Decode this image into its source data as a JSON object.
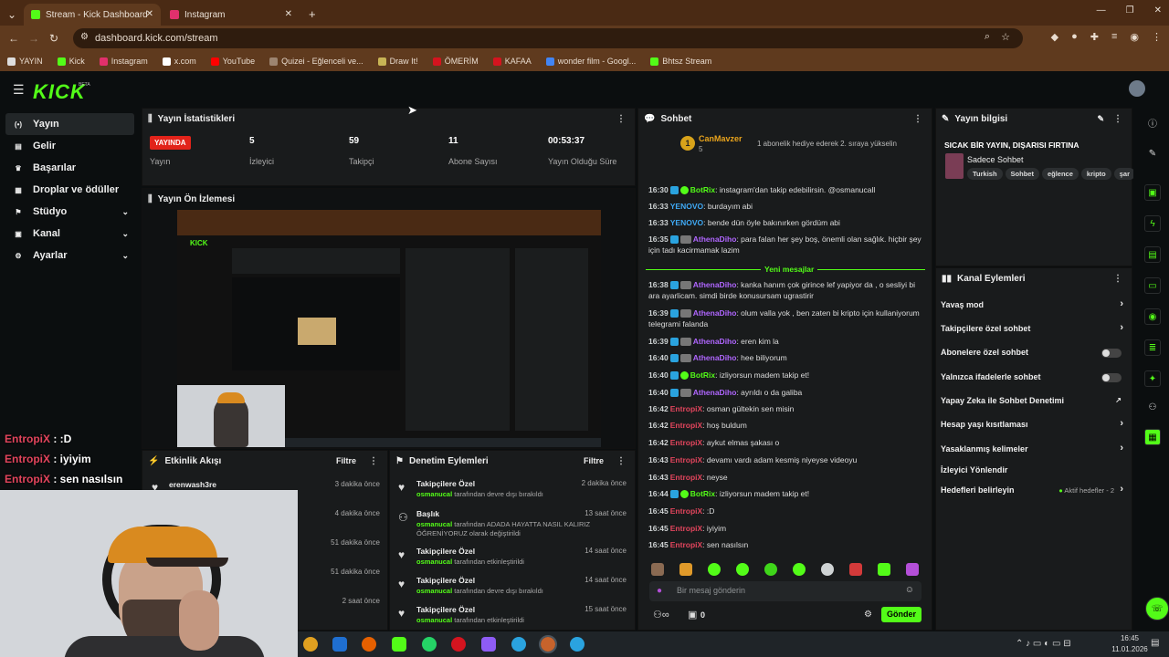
{
  "browser": {
    "tabs": [
      {
        "title": "Stream - Kick Dashboard",
        "active": true
      },
      {
        "title": "Instagram",
        "active": false
      }
    ],
    "url": "dashboard.kick.com/stream",
    "bookmarks": [
      "YAYIN",
      "Kick",
      "Instagram",
      "x.com",
      "YouTube",
      "Quizei - Eğlenceli ve...",
      "Draw It!",
      "ÖMERİM",
      "KAFAA",
      "wonder film - Googl...",
      "Bhtsz Stream"
    ]
  },
  "kick": {
    "logo": "KICK",
    "beta": "BETA",
    "sidebar": [
      {
        "label": "Yayın",
        "icon": "broadcast-icon",
        "active": true
      },
      {
        "label": "Gelir",
        "icon": "revenue-icon"
      },
      {
        "label": "Başarılar",
        "icon": "trophy-icon"
      },
      {
        "label": "Droplar ve ödüller",
        "icon": "gift-icon"
      },
      {
        "label": "Stüdyo",
        "icon": "studio-icon",
        "chevron": true
      },
      {
        "label": "Kanal",
        "icon": "channel-icon",
        "chevron": true
      },
      {
        "label": "Ayarlar",
        "icon": "gear-icon",
        "chevron": true
      }
    ],
    "stats": {
      "title": "Yayın İstatistikleri",
      "live_badge": "YAYINDA",
      "live_label": "Yayın",
      "viewers": "5",
      "viewers_label": "İzleyici",
      "followers": "59",
      "followers_label": "Takipçi",
      "subs": "11",
      "subs_label": "Abone Sayısı",
      "uptime": "00:53:37",
      "uptime_label": "Yayın Olduğu Süre"
    },
    "preview_title": "Yayın Ön İzlemesi",
    "overlay_chat": [
      {
        "user": "EntropiX",
        "msg": " : :D"
      },
      {
        "user": "EntropiX",
        "msg": " : iyiyim"
      },
      {
        "user": "EntropiX",
        "msg": " : sen nasılsın"
      }
    ],
    "activity": {
      "title": "Etkinlik Akışı",
      "filter": "Filtre",
      "items": [
        {
          "user": "erenwash3re",
          "time": "3 dakika önce"
        },
        {
          "user": "",
          "time": "4 dakika önce"
        },
        {
          "user": "",
          "time": "51 dakika önce"
        },
        {
          "user": "",
          "time": "51 dakika önce"
        },
        {
          "user": "",
          "time": "2 saat önce"
        }
      ]
    },
    "moderation": {
      "title": "Denetim Eylemleri",
      "filter": "Filtre",
      "items": [
        {
          "title": "Takipçilere Özel",
          "user": "osmanucal",
          "desc": " tarafından devre dışı bırakıldı",
          "time": "2 dakika önce"
        },
        {
          "title": "Başlık",
          "user": "osmanucal",
          "desc": " tarafından ADADA HAYATTA NASIL KALIRIZ ÖĞRENİYORUZ olarak değiştirildi",
          "time": "13 saat önce"
        },
        {
          "title": "Takipçilere Özel",
          "user": "osmanucal",
          "desc": " tarafından etkinleştirildi",
          "time": "14 saat önce"
        },
        {
          "title": "Takipçilere Özel",
          "user": "osmanucal",
          "desc": " tarafından devre dışı bırakıldı",
          "time": "14 saat önce"
        },
        {
          "title": "Takipçilere Özel",
          "user": "osmanucal",
          "desc": " tarafından etkinleştirildi",
          "time": "15 saat önce"
        }
      ]
    },
    "chat": {
      "title": "Sohbet",
      "pinned_user": "CanMavzer",
      "pinned_count": "5",
      "pinned_msg": "1 abonelik hediye ederek 2. sıraya yükselin",
      "new_messages": "Yeni mesajlar",
      "messages": [
        {
          "time": "16:30",
          "user": "BotRix",
          "color": "#53fc18",
          "text": ": instagram'dan takip edebilirsin. @osmanucall"
        },
        {
          "time": "16:33",
          "user": "YENOVO",
          "color": "#3fa9f5",
          "text": ": burdayım abi"
        },
        {
          "time": "16:33",
          "user": "YENOVO",
          "color": "#3fa9f5",
          "text": ": bende dün öyle bakınırken gördüm abi"
        },
        {
          "time": "16:35",
          "user": "AthenaDiho",
          "color": "#b066ff",
          "text": ": para falan her şey boş, önemli olan sağlık. hiçbir şey için tadı kacirmamak lazim"
        },
        {
          "time": "16:38",
          "user": "AthenaDiho",
          "color": "#b066ff",
          "text": ": kanka hanım çok girince lef yapiyor da , o sesliyi bi ara ayarlicam. simdi birde konusursam ugrastirir"
        },
        {
          "time": "16:39",
          "user": "AthenaDiho",
          "color": "#b066ff",
          "text": ": olum valla yok , ben zaten bi kripto için kullaniyorum telegrami falanda"
        },
        {
          "time": "16:39",
          "user": "AthenaDiho",
          "color": "#b066ff",
          "text": ": eren kim la"
        },
        {
          "time": "16:40",
          "user": "AthenaDiho",
          "color": "#b066ff",
          "text": ": hee biliyorum"
        },
        {
          "time": "16:40",
          "user": "BotRix",
          "color": "#53fc18",
          "text": ": izliyorsun madem takip et!"
        },
        {
          "time": "16:40",
          "user": "AthenaDiho",
          "color": "#b066ff",
          "text": ": ayrıldı o da galiba"
        },
        {
          "time": "16:42",
          "user": "EntropiX",
          "color": "#e3455d",
          "text": ": osman gültekin sen misin"
        },
        {
          "time": "16:42",
          "user": "EntropiX",
          "color": "#e3455d",
          "text": ": hoş buldum"
        },
        {
          "time": "16:42",
          "user": "EntropiX",
          "color": "#e3455d",
          "text": ": aykut elmas şakası o"
        },
        {
          "time": "16:43",
          "user": "EntropiX",
          "color": "#e3455d",
          "text": ": devamı vardı adam kesmiş niyeyse videoyu"
        },
        {
          "time": "16:43",
          "user": "EntropiX",
          "color": "#e3455d",
          "text": ": neyse"
        },
        {
          "time": "16:44",
          "user": "BotRix",
          "color": "#53fc18",
          "text": ": izliyorsun madem takip et!"
        },
        {
          "time": "16:45",
          "user": "EntropiX",
          "color": "#e3455d",
          "text": ": :D"
        },
        {
          "time": "16:45",
          "user": "EntropiX",
          "color": "#e3455d",
          "text": ": iyiyim"
        },
        {
          "time": "16:45",
          "user": "EntropiX",
          "color": "#e3455d",
          "text": ": sen nasılsın"
        }
      ],
      "input_placeholder": "Bir mesaj gönderin",
      "send_label": "Gönder",
      "count": "0"
    },
    "stream_info": {
      "title": "Yayın bilgisi",
      "stream_title": "SICAK BİR YAYIN, DIŞARISI FIRTINA",
      "category": "Sadece Sohbet",
      "tags": [
        "Turkish",
        "Sohbet",
        "eğlence",
        "kripto",
        "şar"
      ]
    },
    "channel_actions": {
      "title": "Kanal Eylemleri",
      "items": [
        {
          "label": "Yavaş mod",
          "type": "chevron"
        },
        {
          "label": "Takipçilere özel sohbet",
          "type": "chevron"
        },
        {
          "label": "Abonelere özel sohbet",
          "type": "toggle"
        },
        {
          "label": "Yalnızca ifadelerle sohbet",
          "type": "toggle"
        },
        {
          "label": "Yapay Zeka ile Sohbet Denetimi",
          "type": "external"
        },
        {
          "label": "Hesap yaşı kısıtlaması",
          "type": "chevron"
        },
        {
          "label": "Yasaklanmış kelimeler",
          "type": "chevron"
        },
        {
          "label": "İzleyici Yönlendir",
          "type": "none"
        },
        {
          "label": "Hedefleri belirleyin",
          "type": "chevron"
        }
      ],
      "goals_status": "Aktif hedefler - 2"
    }
  },
  "taskbar": {
    "time": "16:45",
    "date": "11.01.2026"
  },
  "colors": {
    "accent": "#53fc18",
    "live": "#e2231a",
    "panel": "#191b1c",
    "bg": "#0b0e0f"
  }
}
